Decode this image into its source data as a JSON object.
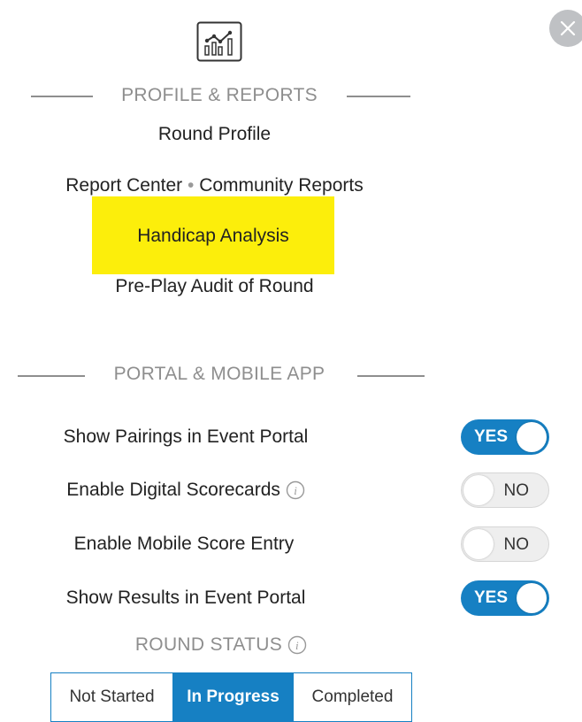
{
  "icons": {
    "close": "close-icon",
    "reports": "bar-chart-trend-icon",
    "info": "info-icon"
  },
  "colors": {
    "accent": "#1680c3",
    "highlight": "#fcee0b",
    "section_heading": "#8e8e8e",
    "close_button": "#bfc1c4"
  },
  "profile_reports": {
    "heading": "PROFILE & REPORTS",
    "round_profile": "Round Profile",
    "report_center": "Report Center",
    "separator": "•",
    "community_reports": "Community Reports",
    "handicap_analysis": "Handicap Analysis",
    "pre_play_audit": "Pre-Play Audit of Round"
  },
  "portal_mobile": {
    "heading": "PORTAL & MOBILE APP",
    "settings": [
      {
        "label": "Show Pairings in Event Portal",
        "state": "YES",
        "on": true,
        "info": false
      },
      {
        "label": "Enable Digital Scorecards",
        "state": "NO",
        "on": false,
        "info": true
      },
      {
        "label": "Enable Mobile Score Entry",
        "state": "NO",
        "on": false,
        "info": false
      },
      {
        "label": "Show Results in Event Portal",
        "state": "YES",
        "on": true,
        "info": false
      }
    ]
  },
  "round_status": {
    "heading": "ROUND STATUS",
    "options": [
      "Not Started",
      "In Progress",
      "Completed"
    ],
    "selected": "In Progress"
  }
}
